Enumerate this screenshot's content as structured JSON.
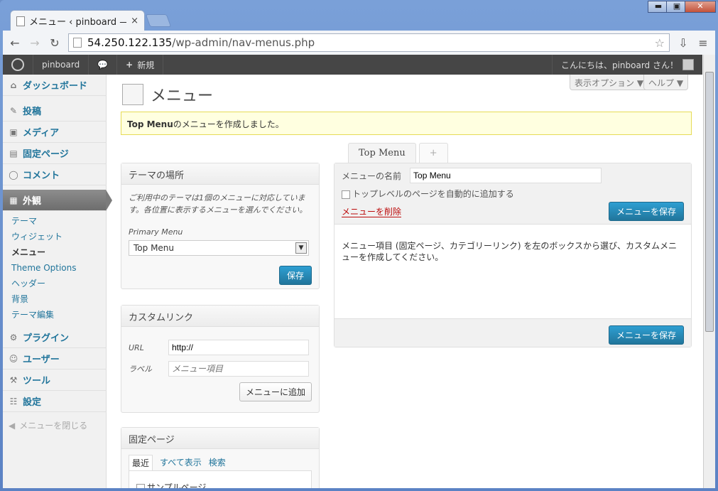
{
  "browser": {
    "tab_title": "メニュー ‹ pinboard — W",
    "tab_close": "×",
    "url_host": "54.250.122.135",
    "url_path": "/wp-admin/nav-menus.php",
    "win_min": "▬",
    "win_max": "▣",
    "win_close": "✕"
  },
  "adminbar": {
    "site": "pinboard",
    "new_label": "新規",
    "new_icon": "+",
    "greeting": "こんにちは、pinboard さん！"
  },
  "sidebar": {
    "dashboard": "ダッシュボード",
    "posts": "投稿",
    "media": "メディア",
    "pages": "固定ページ",
    "comments": "コメント",
    "appearance": "外観",
    "sub": [
      "テーマ",
      "ウィジェット",
      "メニュー",
      "Theme Options",
      "ヘッダー",
      "背景",
      "テーマ編集"
    ],
    "plugins": "プラグイン",
    "users": "ユーザー",
    "tools": "ツール",
    "settings": "設定",
    "collapse": "メニューを閉じる"
  },
  "main": {
    "title": "メニュー",
    "screen_options": "表示オプション ▼",
    "help": "ヘルプ ▼",
    "notice_bold": "Top Menu",
    "notice_rest": "のメニューを作成しました。",
    "tab_active": "Top Menu",
    "tab_add": "+"
  },
  "locations": {
    "title": "テーマの場所",
    "desc": "ご利用中のテーマは1個のメニューに対応しています。各位置に表示するメニューを選んでください。",
    "primary_label": "Primary Menu",
    "primary_value": "Top Menu",
    "save": "保存"
  },
  "custom_links": {
    "title": "カスタムリンク",
    "url_label": "URL",
    "url_value": "http://",
    "label_label": "ラベル",
    "label_placeholder": "メニュー項目",
    "add": "メニューに追加"
  },
  "pages_box": {
    "title": "固定ページ",
    "tabs": [
      "最近",
      "すべて表示",
      "検索"
    ],
    "first_item": "サンプルページ"
  },
  "menu_editor": {
    "name_label": "メニューの名前",
    "name_value": "Top Menu",
    "auto_add": "トップレベルのページを自動的に追加する",
    "delete": "メニューを削除",
    "save": "メニューを保存",
    "instructions": "メニュー項目 (固定ページ、カテゴリーリンク) を左のボックスから選び、カスタムメニューを作成してください。"
  },
  "colors": {
    "accent": "#21759b",
    "notice_bg": "#ffffe0",
    "adminbar": "#464646"
  }
}
